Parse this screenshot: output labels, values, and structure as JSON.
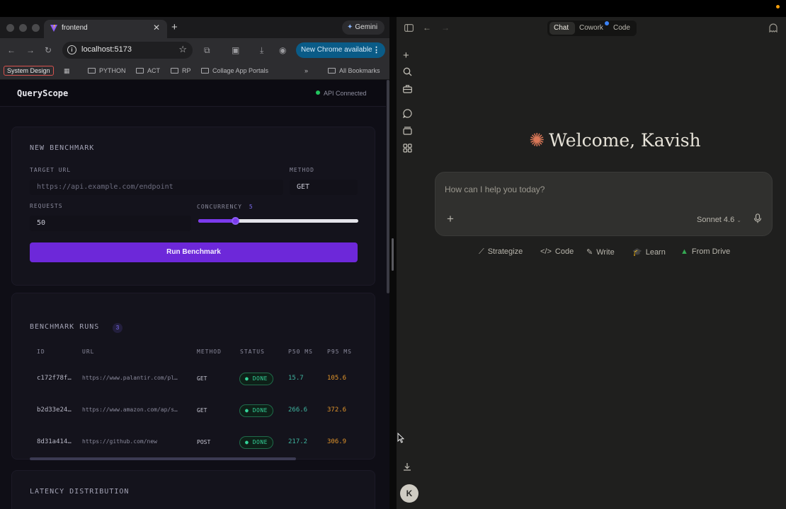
{
  "browser": {
    "tab_title": "frontend",
    "new_tab": "+",
    "gemini_label": "Gemini",
    "url": "localhost:5173",
    "update_pill": "New Chrome available",
    "bookmarks": {
      "system_design": "System Design",
      "items": [
        "PYTHON",
        "ACT",
        "RP",
        "Collage App Portals"
      ],
      "overflow": "»",
      "all": "All Bookmarks"
    }
  },
  "app": {
    "brand": "QueryScope",
    "api_status": "API Connected",
    "new_benchmark": {
      "title": "NEW BENCHMARK",
      "target_url_label": "TARGET URL",
      "target_url_placeholder": "https://api.example.com/endpoint",
      "method_label": "METHOD",
      "method_value": "GET",
      "requests_label": "REQUESTS",
      "requests_value": "50",
      "concurrency_label": "CONCURRENCY",
      "concurrency_value": "5",
      "concurrency_fraction": 0.23,
      "run_button": "Run Benchmark"
    },
    "runs": {
      "title": "BENCHMARK RUNS",
      "count": "3",
      "columns": [
        "ID",
        "URL",
        "METHOD",
        "STATUS",
        "P50 MS",
        "P95 MS"
      ],
      "rows": [
        {
          "id": "c172f78f…",
          "url": "https://www.palantir.com/pl…",
          "method": "GET",
          "status": "DONE",
          "p50": "15.7",
          "p95": "105.6"
        },
        {
          "id": "b2d33e24…",
          "url": "https://www.amazon.com/ap/s…",
          "method": "GET",
          "status": "DONE",
          "p50": "266.6",
          "p95": "372.6"
        },
        {
          "id": "8d31a414…",
          "url": "https://github.com/new",
          "method": "POST",
          "status": "DONE",
          "p50": "217.2",
          "p95": "306.9"
        }
      ]
    },
    "latency": {
      "title": "LATENCY DISTRIBUTION"
    }
  },
  "claude": {
    "tabs": [
      "Chat",
      "Cowork",
      "Code"
    ],
    "welcome": "Welcome, Kavish",
    "placeholder": "How can I help you today?",
    "model": "Sonnet 4.6",
    "chips": [
      "Strategize",
      "Code",
      "Write",
      "Learn",
      "From Drive"
    ],
    "avatar_initial": "K"
  },
  "colors": {
    "accent_purple": "#6d28d9",
    "status_green": "#34d399",
    "p50_teal": "#3fb5a0",
    "p95_orange": "#e0942b",
    "claude_spark": "#d97757"
  }
}
